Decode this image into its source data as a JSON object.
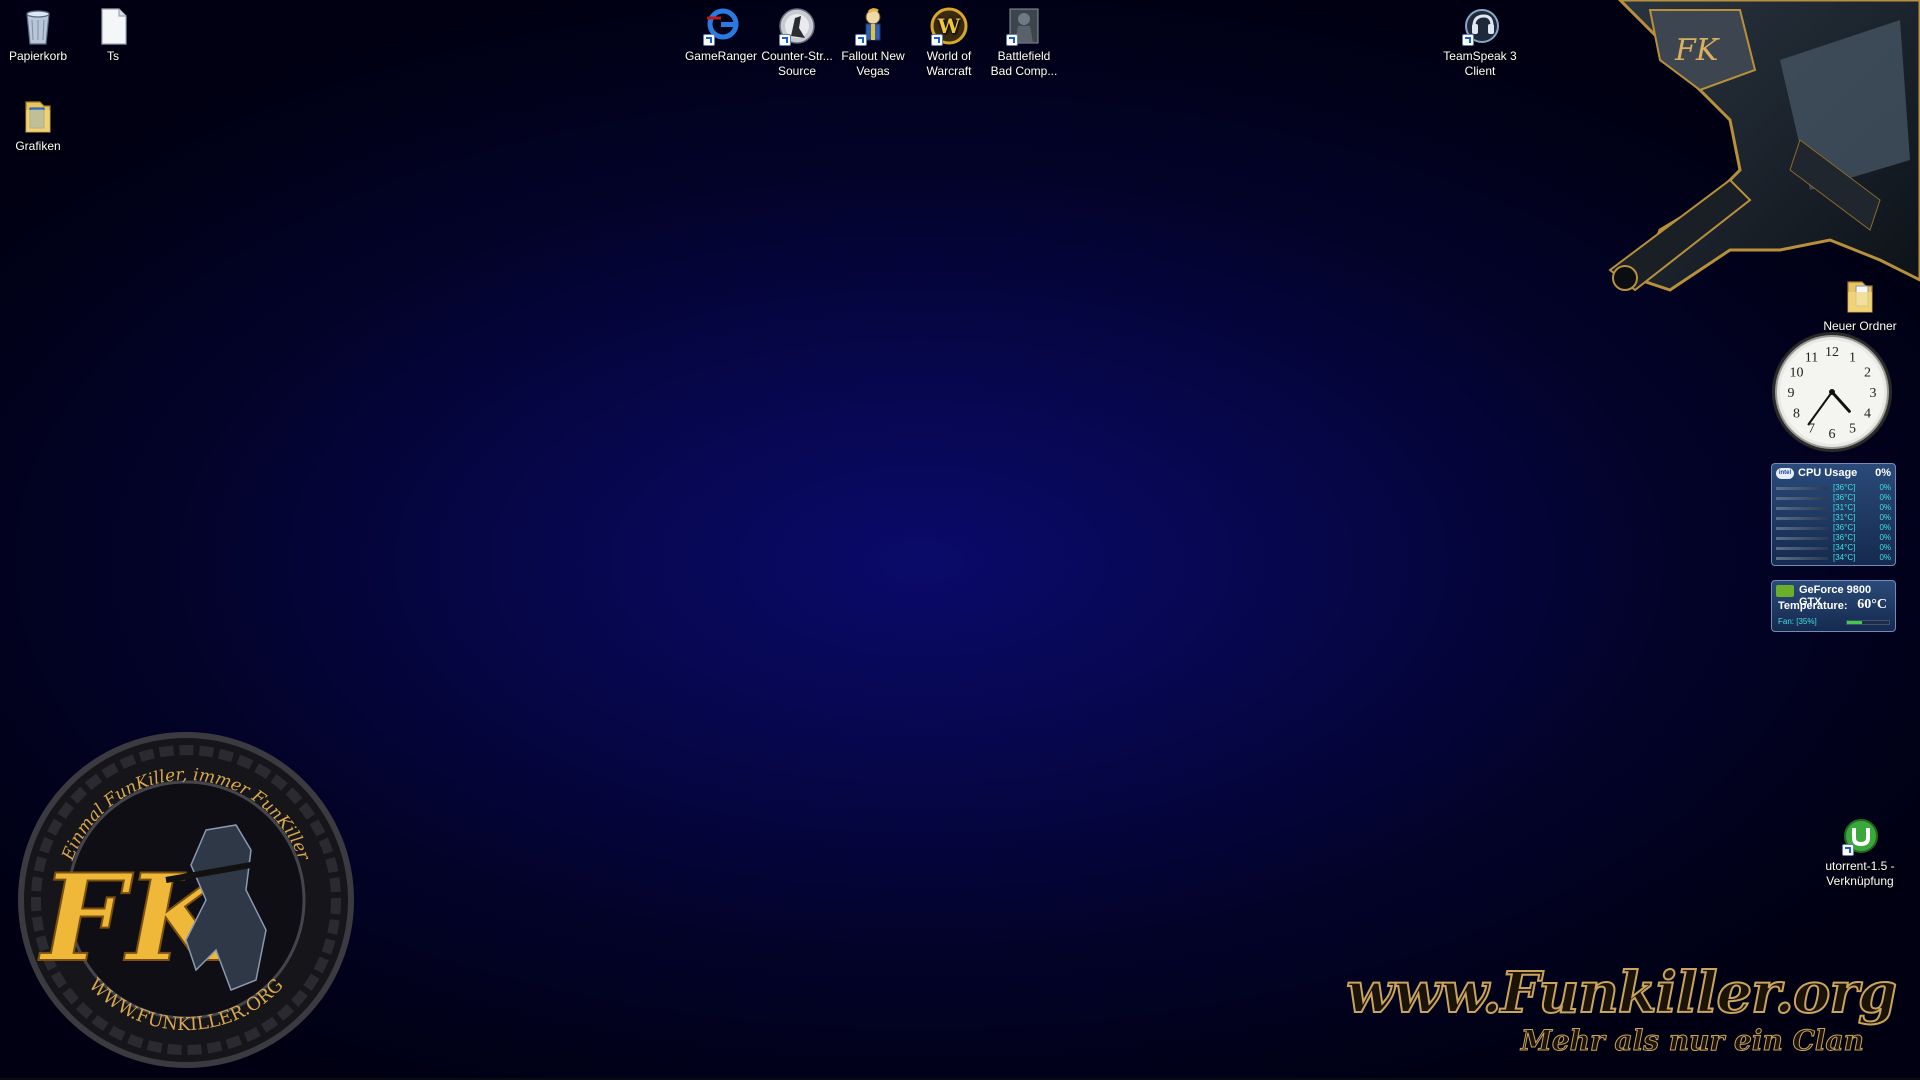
{
  "desktop": {
    "icons": [
      {
        "id": "recycle-bin",
        "label": "Papierkorb",
        "icon": "recycle-bin-icon"
      },
      {
        "id": "ts-file",
        "label": "Ts",
        "icon": "text-file-icon"
      },
      {
        "id": "grafiken",
        "label": "Grafiken",
        "icon": "folder-icon"
      },
      {
        "id": "gameranger",
        "label": "GameRanger",
        "icon": "gameranger-icon"
      },
      {
        "id": "counter-strike",
        "label": "Counter-Str... Source",
        "icon": "counter-strike-icon"
      },
      {
        "id": "fallout",
        "label": "Fallout New Vegas",
        "icon": "fallout-vaultboy-icon"
      },
      {
        "id": "wow",
        "label": "World of Warcraft",
        "icon": "world-of-warcraft-icon"
      },
      {
        "id": "battlefield",
        "label": "Battlefield Bad Comp...",
        "icon": "battlefield-icon"
      },
      {
        "id": "teamspeak",
        "label": "TeamSpeak 3 Client",
        "icon": "teamspeak-icon"
      },
      {
        "id": "neuer-ordner",
        "label": "Neuer Ordner",
        "icon": "folder-icon"
      },
      {
        "id": "utorrent",
        "label": "utorrent-1.5 - Verknüpfung",
        "icon": "utorrent-icon"
      }
    ]
  },
  "clock": {
    "numerals": [
      "12",
      "1",
      "2",
      "3",
      "4",
      "5",
      "6",
      "7",
      "8",
      "9",
      "10",
      "11"
    ],
    "time_hour": 4,
    "time_minute": 36
  },
  "cpu_gadget": {
    "title": "CPU Usage",
    "total": "0%",
    "logo_text": "intel",
    "cores": [
      {
        "temp": "[36°C]",
        "pct": "0%"
      },
      {
        "temp": "[36°C]",
        "pct": "0%"
      },
      {
        "temp": "[31°C]",
        "pct": "0%"
      },
      {
        "temp": "[31°C]",
        "pct": "0%"
      },
      {
        "temp": "[36°C]",
        "pct": "0%"
      },
      {
        "temp": "[36°C]",
        "pct": "0%"
      },
      {
        "temp": "[34°C]",
        "pct": "0%"
      },
      {
        "temp": "[34°C]",
        "pct": "0%"
      }
    ]
  },
  "gpu_gadget": {
    "name": "GeForce 9800 GTX",
    "temp_label": "Temperature:",
    "temp_value": "60°C",
    "fan_label": "Fan: [35%]",
    "fan_fraction": 0.35
  },
  "wallpaper": {
    "emblem_ring_text": "Einmal FunKiller, immer FunKiller",
    "emblem_url": "WWW.FUNKILLER.ORG",
    "emblem_letters": "FK",
    "brand_url": "www.Funkiller.org",
    "brand_tagline": "Mehr als nur ein Clan",
    "colors": {
      "gold": "#c9a45c",
      "background": "#06064a"
    }
  }
}
